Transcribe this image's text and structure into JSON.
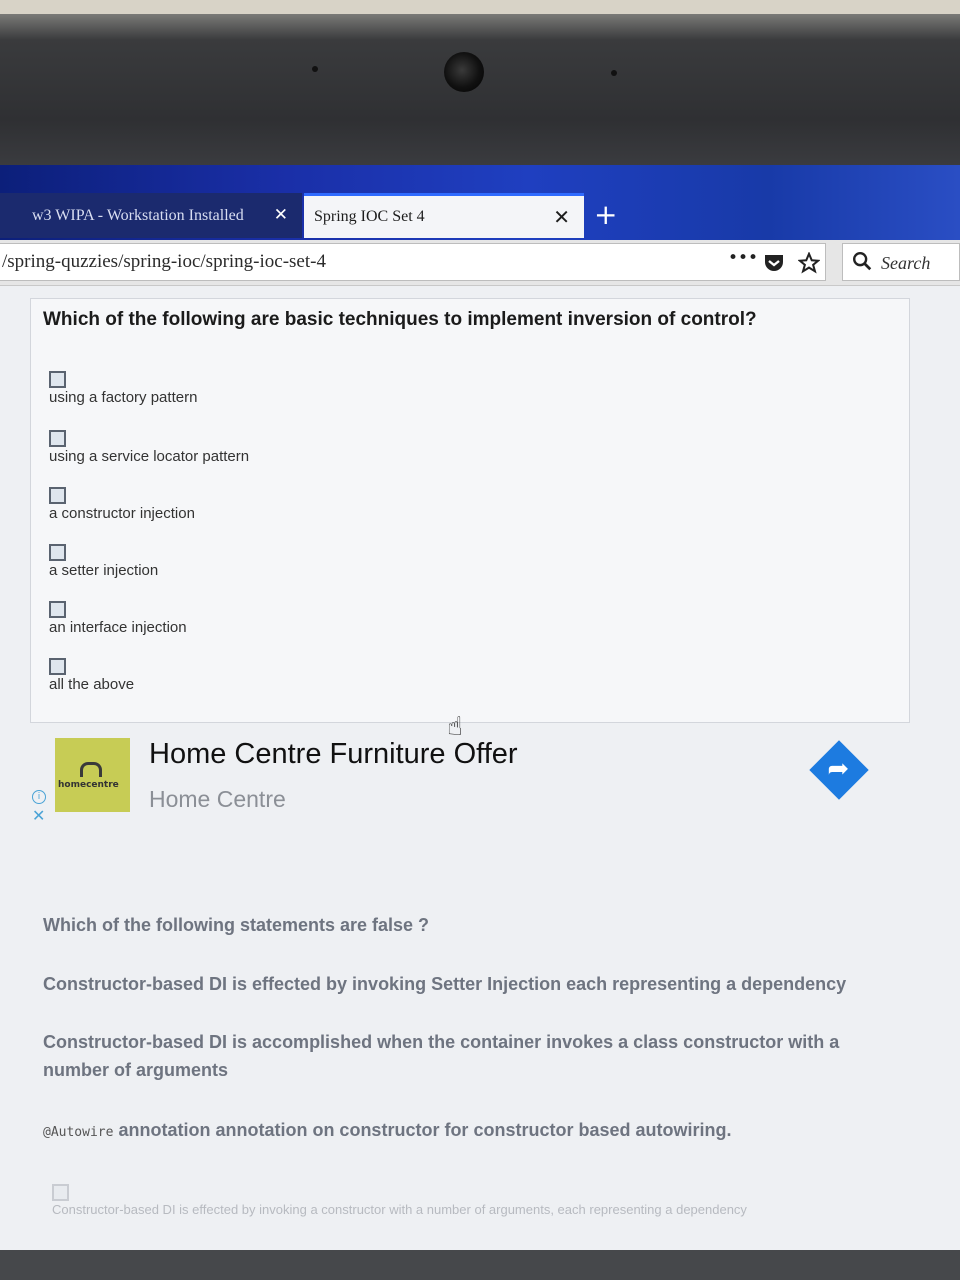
{
  "browser": {
    "tabs": [
      {
        "label": "w3  WIPA - Workstation Installed",
        "active": false
      },
      {
        "label": "Spring IOC Set 4",
        "active": true
      }
    ],
    "close_glyph": "✕",
    "new_tab_glyph": "+",
    "back_glyph": "‹",
    "url": "/spring-quzzies/spring-ioc/spring-ioc-set-4",
    "menu_glyph": "•••",
    "search_placeholder": "Search"
  },
  "question1": {
    "text": "Which of the following  are basic techniques to implement inversion of control?",
    "options": [
      "using a factory pattern",
      "using a service locator pattern",
      "a constructor injection",
      "a setter injection",
      "an interface injection",
      "all the above"
    ]
  },
  "ad": {
    "logo_text": "homecentre",
    "title": "Home Centre Furniture Offer",
    "subtitle": "Home Centre",
    "info_glyph": "i",
    "close_glyph": "✕",
    "arrow_glyph": "➦"
  },
  "question2": {
    "text": "Which of the following statements  are false ?",
    "statements": [
      "Constructor-based DI is effected by invoking Setter Injection each representing a dependency",
      "Constructor-based DI is accomplished when the container invokes a class constructor with a number of arguments",
      "annotation annotation on constructor for constructor based autowiring.",
      "Constructor-based DI is effected by invoking a constructor with a number of arguments, each representing a dependency"
    ],
    "code_label": "@Autowire"
  },
  "colors": {
    "tabbar": "#1a2fa8",
    "ad_arrow": "#1d7be0",
    "ad_logo": "#c7cc55"
  }
}
